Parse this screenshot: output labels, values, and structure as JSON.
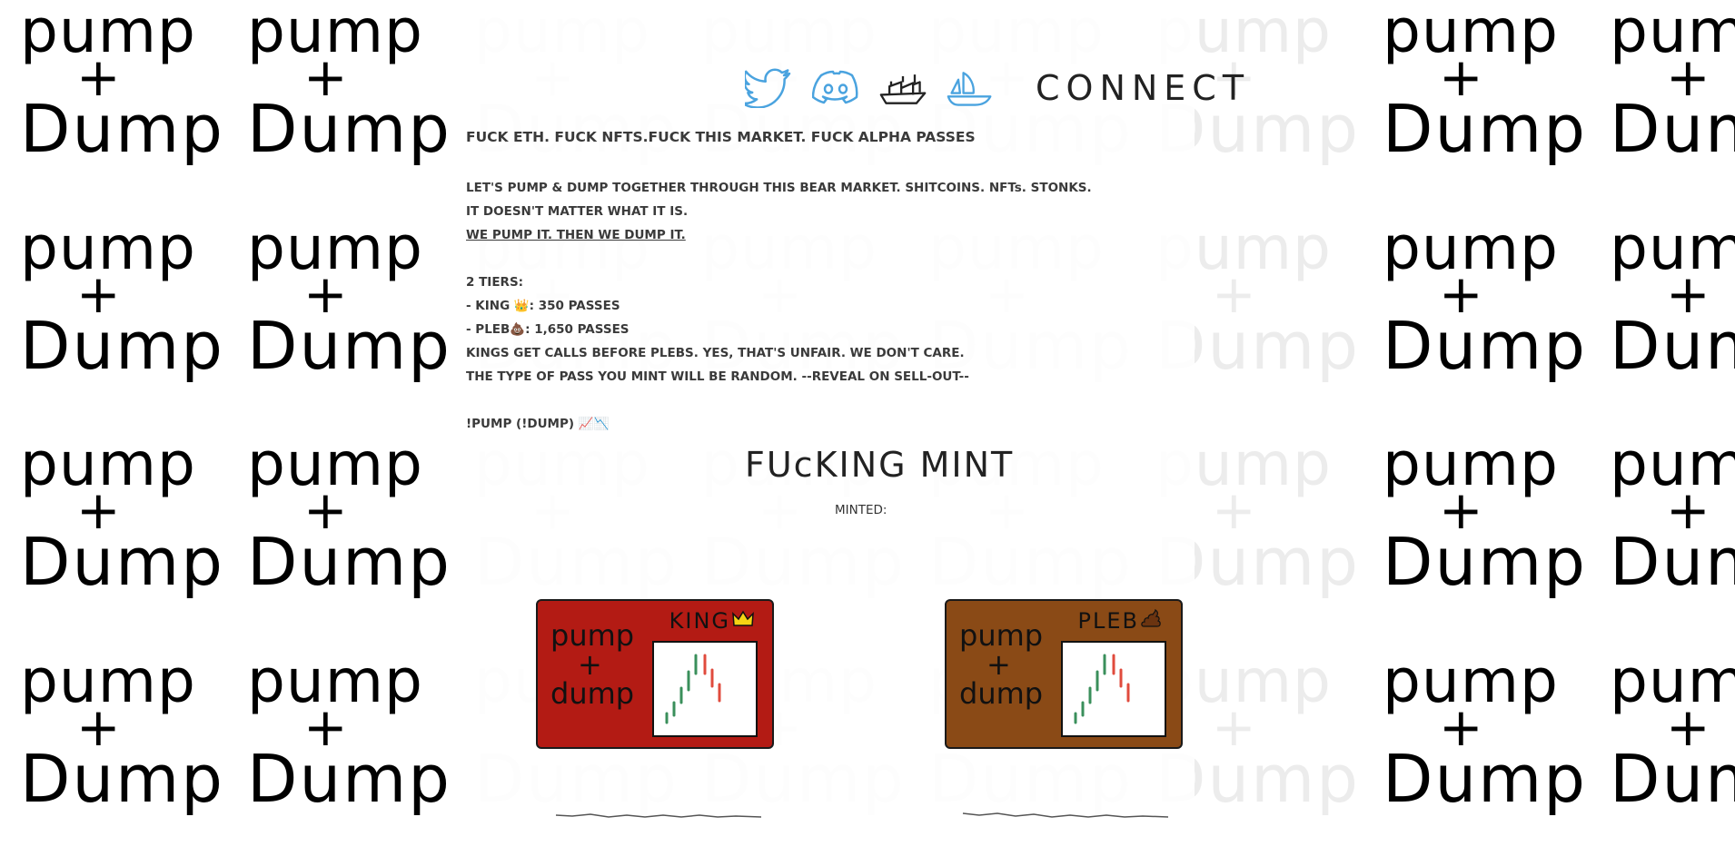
{
  "background": {
    "tile_word_top": "pump",
    "tile_plus": "+",
    "tile_word_bottom": "Dump"
  },
  "nav": {
    "icons": [
      "twitter-icon",
      "discord-icon",
      "ship-icon",
      "opensea-icon"
    ],
    "connect_label": "CONNECT"
  },
  "manifesto": {
    "headline": "FUCK ETH. FUCK NFTS.FUCK THIS MARKET. FUCK ALPHA PASSES",
    "line1": "LET'S PUMP & DUMP TOGETHER THROUGH THIS BEAR MARKET. SHITCOINS. NFTs. STONKS.",
    "line2": "IT DOESN'T MATTER WHAT IT IS.",
    "line3": "WE PUMP IT. THEN WE DUMP IT.",
    "tiers_title": "2 TIERS:",
    "tier_king": "- KING 👑: 350 PASSES",
    "tier_pleb": "- PLEB💩: 1,650 PASSES",
    "line4": "KINGS GET CALLS BEFORE PLEBS. YES, THAT'S UNFAIR. WE DON'T CARE.",
    "line5": "THE TYPE OF PASS YOU MINT WILL BE RANDOM. --REVEAL ON SELL-OUT--",
    "footer": "!PUMP (!DUMP) 📈📉"
  },
  "mint": {
    "title": "FUcKING MINT",
    "minted_label": "MINTED:"
  },
  "cards": {
    "king": {
      "label": "KING",
      "word_top": "pump",
      "plus": "+",
      "word_bottom": "dump",
      "color": "#b31b14"
    },
    "pleb": {
      "label": "PLEB",
      "word_top": "pump",
      "plus": "+",
      "word_bottom": "dump",
      "color": "#8a4a16"
    }
  },
  "colors": {
    "twitter": "#4aa3df",
    "candle_up": "#3a8f5b",
    "candle_down": "#e04b3d"
  }
}
